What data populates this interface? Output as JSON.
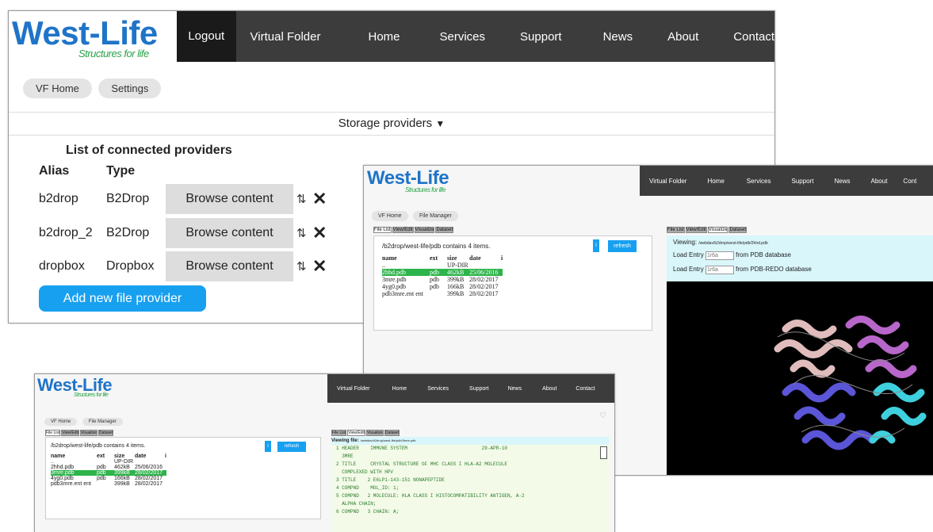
{
  "main": {
    "logo": {
      "title": "West-Life",
      "subtitle": "Structures for life"
    },
    "nav": [
      "Logout",
      "Virtual Folder",
      "Home",
      "Services",
      "Support",
      "News",
      "About",
      "Contact"
    ],
    "subnav": [
      "VF Home",
      "Settings"
    ],
    "storage_label": "Storage providers",
    "list_title": "List of connected providers",
    "col_alias": "Alias",
    "col_type": "Type",
    "providers": [
      {
        "alias": "b2drop",
        "type": "B2Drop",
        "browse": "Browse content"
      },
      {
        "alias": "b2drop_2",
        "type": "B2Drop",
        "browse": "Browse content"
      },
      {
        "alias": "dropbox",
        "type": "Dropbox",
        "browse": "Browse content"
      }
    ],
    "add_button": "Add new file provider"
  },
  "viewer": {
    "logo": {
      "title": "West-Life",
      "subtitle": "Structures for life"
    },
    "nav": [
      "Virtual Folder",
      "Home",
      "Services",
      "Support",
      "News",
      "About",
      "Cont"
    ],
    "subnav": [
      "VF Home",
      "File Manager"
    ],
    "left_tabs": [
      "File List",
      "View/Edit",
      "Visualize",
      "Dataset"
    ],
    "path": "/b2drop/west-life/pdb contains  4 items.",
    "refresh": "refresh",
    "headers": [
      "name",
      "ext",
      "size",
      "date",
      "i"
    ],
    "updir": "UP-DIR",
    "files": [
      {
        "name": "..",
        "ext": "",
        "size": "",
        "date": ""
      },
      {
        "name": "2hhd.pdb",
        "ext": "pdb",
        "size": "462kB",
        "date": "25/06/2016"
      },
      {
        "name": "3mre.pdb",
        "ext": "pdb",
        "size": "399kB",
        "date": "28/02/2017"
      },
      {
        "name": "4yg0.pdb",
        "ext": "pdb",
        "size": "166kB",
        "date": "28/02/2017"
      },
      {
        "name": "pdb3mre.ent ent",
        "ext": "",
        "size": "399kB",
        "date": "28/02/2017"
      }
    ],
    "right_tabs": [
      "File List",
      "View/Edit",
      "Visualize",
      "Dataset"
    ],
    "viewing": "Viewing:",
    "viewing_path": "/webdav/b2drop/west-life/pdb/2hhd.pdb",
    "load1_label": "Load Entry",
    "load1_placeholder": "1r6a",
    "load1_suffix": "from PDB database",
    "load2_label": "Load Entry",
    "load2_placeholder": "1r6a",
    "load2_suffix": "from PDB-REDO database"
  },
  "editor": {
    "logo": {
      "title": "West-Life",
      "subtitle": "Structures for life"
    },
    "nav": [
      "Virtual Folder",
      "Home",
      "Services",
      "Support",
      "News",
      "About",
      "Contact"
    ],
    "subnav": [
      "VF Home",
      "File Manager"
    ],
    "left_tabs": [
      "File List",
      "View/Edit",
      "Visualize",
      "Dataset"
    ],
    "path": "/b2drop/west-life/pdb contains  4 items.",
    "refresh": "refresh",
    "headers": [
      "name",
      "ext",
      "size",
      "date",
      "i"
    ],
    "updir": "UP-DIR",
    "files": [
      {
        "name": "..",
        "ext": "",
        "size": "",
        "date": ""
      },
      {
        "name": "2hhd.pdb",
        "ext": "pdb",
        "size": "462kB",
        "date": "25/06/2016"
      },
      {
        "name": "3mre.pdb",
        "ext": "pdb",
        "size": "399kB",
        "date": "28/02/2017"
      },
      {
        "name": "4yg0.pdb",
        "ext": "pdb",
        "size": "166kB",
        "date": "28/02/2017"
      },
      {
        "name": "pdb3mre.ent ent",
        "ext": "",
        "size": "399kB",
        "date": "28/02/2017"
      }
    ],
    "right_tabs": [
      "File List",
      "View/Edit",
      "Visualize",
      "Dataset"
    ],
    "viewing": "Viewing file:",
    "viewing_path": "/webdav/b2drop/west-life/pdb/3mre.pdb",
    "code_lines": [
      "1 HEADER    IMMUNE SYSTEM                          29-APR-10",
      "  3MRE",
      "2 TITLE     CRYSTAL STRUCTURE OF MHC CLASS I HLA-A2 MOLECULE",
      "  COMPLEXED WITH HPV",
      "3 TITLE    2 E6LP1-143-151 NONAPEPTIDE",
      "4 COMPND    MOL_ID: 1;",
      "5 COMPND   2 MOLECULE: HLA CLASS I HISTOCOMPATIBILITY ANTIGEN, A-2",
      "  ALPHA CHAIN;",
      "6 COMPND   3 CHAIN: A;"
    ]
  },
  "colors": {
    "brand_blue": "#1f74c8",
    "nav_dark": "#3c3c3c",
    "accent_button": "#18a0f0",
    "highlight_green": "#2db44a",
    "viewer_panel": "#d9f6fb"
  }
}
